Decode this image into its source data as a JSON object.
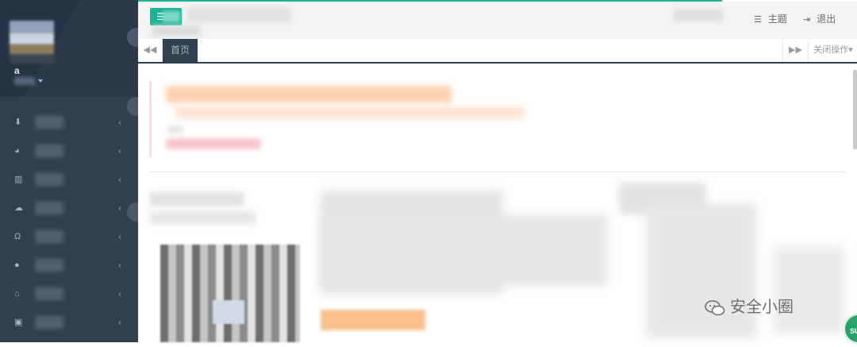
{
  "sidebar": {
    "user": {
      "name": "a",
      "role_caret": "▾"
    },
    "items": [
      {
        "icon": "download-icon",
        "glyph": "⬇",
        "label": "",
        "arrow": "‹"
      },
      {
        "icon": "pie-chart-icon",
        "glyph": "◕",
        "label": "",
        "arrow": "‹"
      },
      {
        "icon": "bar-chart-icon",
        "glyph": "▥",
        "label": "",
        "arrow": "‹"
      },
      {
        "icon": "cloud-icon",
        "glyph": "☁",
        "label": "",
        "arrow": "‹"
      },
      {
        "icon": "headphones-icon",
        "glyph": "Ω",
        "label": "",
        "arrow": "‹"
      },
      {
        "icon": "comment-icon",
        "glyph": "●",
        "label": "",
        "arrow": "‹"
      },
      {
        "icon": "home-icon",
        "glyph": "⌂",
        "label": "",
        "arrow": "‹"
      },
      {
        "icon": "twitch-icon",
        "glyph": "▣",
        "label": "",
        "arrow": "‹"
      }
    ]
  },
  "header": {
    "menu_glyph": "☰",
    "theme_label": "主题",
    "theme_icon": "theme-icon",
    "logout_label": "退出",
    "logout_icon": "logout-icon"
  },
  "tabs": {
    "nav_left": "◀◀",
    "home_label": "首页",
    "nav_right": "▶▶",
    "close_ops": "关闭操作▾"
  },
  "watermark": {
    "text": "安全小圈"
  },
  "badge": {
    "text": "SU"
  },
  "colors": {
    "accent": "#1ab394",
    "sidebar": "#2f4050",
    "sidebar_text": "#a7b1c2"
  }
}
